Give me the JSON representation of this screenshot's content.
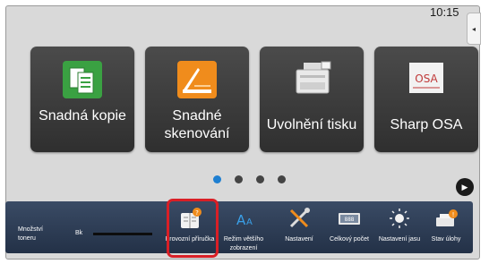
{
  "status": {
    "clock": "10:15",
    "side_tab_icon": "chevron-left-icon"
  },
  "tiles": [
    {
      "label": "Snadná kopie",
      "icon": "copy-icon",
      "color": "#3aa142"
    },
    {
      "label": "Snadné skenování",
      "icon": "scan-icon",
      "color": "#f08c1c"
    },
    {
      "label": "Uvolnění tisku",
      "icon": "printer-icon",
      "color": "#ffffff"
    },
    {
      "label": "Sharp OSA",
      "icon": "osa-icon",
      "color": "#c03a3a"
    }
  ],
  "pager": {
    "count": 4,
    "active_index": 0,
    "next_icon": "play-icon"
  },
  "toner": {
    "label": "Množství toneru",
    "bk_label": "Bk"
  },
  "shortcuts": [
    {
      "label": "Provozní příručka",
      "icon": "manual-icon",
      "highlighted": true
    },
    {
      "label": "Režim většího zobrazení",
      "icon": "large-text-icon",
      "highlighted": false
    },
    {
      "label": "Nastavení",
      "icon": "wrench-icon",
      "highlighted": false
    },
    {
      "label": "Celkový počet",
      "icon": "counter-icon",
      "highlighted": false
    },
    {
      "label": "Nastavení jasu",
      "icon": "brightness-icon",
      "highlighted": false
    },
    {
      "label": "Stav úlohy",
      "icon": "job-status-icon",
      "highlighted": false
    }
  ],
  "accent_colors": {
    "highlight_frame": "#d91f26",
    "active_dot": "#1e7fd1"
  }
}
